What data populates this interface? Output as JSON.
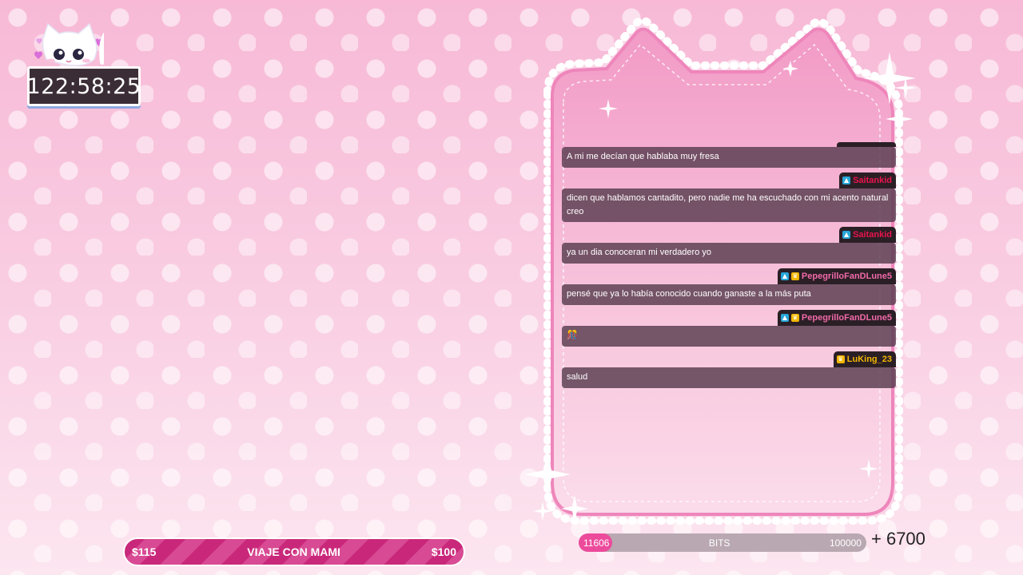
{
  "timer": {
    "value": "122:58:25"
  },
  "chat": {
    "messages": [
      {
        "user": "",
        "user_color": "#ffffff",
        "badges": [],
        "text": "A mi me decían que hablaba muy fresa"
      },
      {
        "user": "Saitankid",
        "user_color": "#e8144c",
        "badges": [
          "blue"
        ],
        "text": "dicen que hablamos cantadito, pero nadie me ha escuchado con mi acento natural creo"
      },
      {
        "user": "Saitankid",
        "user_color": "#e8144c",
        "badges": [
          "blue"
        ],
        "text": "ya un dia conoceran mi verdadero yo"
      },
      {
        "user": "PepegrilloFanDLune5",
        "user_color": "#f06aa8",
        "badges": [
          "blue",
          "gold"
        ],
        "text": "pensé que ya lo había conocido cuando ganaste a la más puta"
      },
      {
        "user": "PepegrilloFanDLune5",
        "user_color": "#f06aa8",
        "badges": [
          "blue",
          "gold"
        ],
        "text": "🎊"
      },
      {
        "user": "LuKing_23",
        "user_color": "#f2b600",
        "badges": [
          "gold"
        ],
        "text": "salud"
      }
    ]
  },
  "goal": {
    "left": "$115",
    "title": "VIAJE CON MAMI",
    "right": "$100",
    "stripe_color": "#c9287a"
  },
  "bits": {
    "current": "11606",
    "label": "BITS",
    "target": "100000",
    "progress": 0.116,
    "extra": "+ 6700",
    "fill_color": "#ec4a9b"
  }
}
